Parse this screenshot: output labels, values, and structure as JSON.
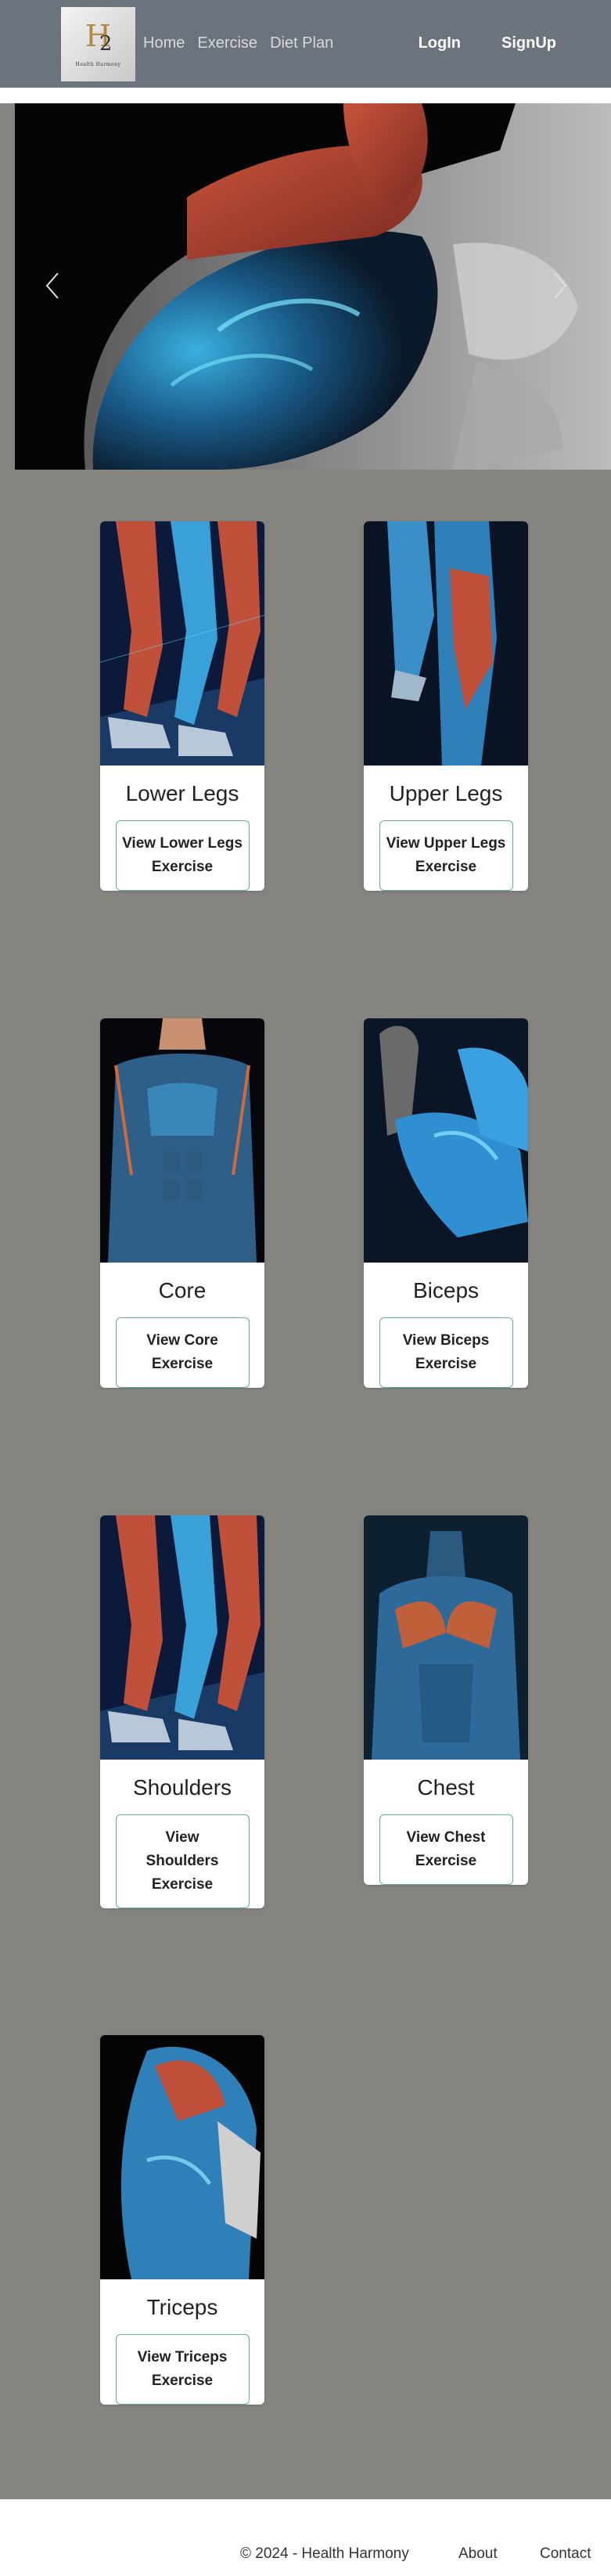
{
  "nav": {
    "logo_mark": "H",
    "logo_sub": "2",
    "logo_caption": "Health Harmony",
    "links": [
      "Home",
      "Exercise",
      "Diet Plan"
    ],
    "login": "LogIn",
    "signup": "SignUp"
  },
  "hero": {
    "prev_icon": "chevron-left-icon",
    "next_icon": "chevron-right-icon"
  },
  "cards": [
    {
      "title": "Lower Legs",
      "button": "View Lower Legs Exercise"
    },
    {
      "title": "Upper Legs",
      "button": "View Upper Legs Exercise"
    },
    {
      "title": "Core",
      "button": "View Core Exercise"
    },
    {
      "title": "Biceps",
      "button": "View Biceps Exercise"
    },
    {
      "title": "Shoulders",
      "button": "View Shoulders Exercise"
    },
    {
      "title": "Chest",
      "button": "View Chest Exercise"
    },
    {
      "title": "Triceps",
      "button": "View Triceps Exercise"
    }
  ],
  "footer": {
    "copyright": "© 2024 - Health Harmony",
    "about": "About",
    "contact": "Contact"
  },
  "colors": {
    "navbar": "#6c737c",
    "page_bg": "#85847f",
    "button_border": "#5fae9a"
  }
}
